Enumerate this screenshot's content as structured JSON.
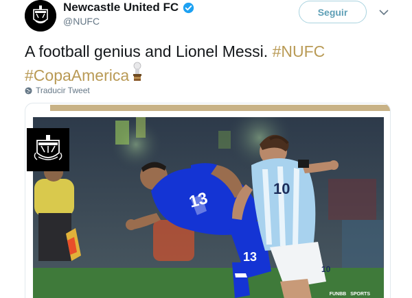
{
  "account": {
    "display_name": "Newcastle United FC",
    "handle": "@NUFC",
    "verified": true
  },
  "follow_button": {
    "label": "Seguir"
  },
  "tweet": {
    "text": "A football genius and Lionel Messi.",
    "hashtags": [
      "#NUFC",
      "#CopaAmerica"
    ],
    "emoji": "trophy-icon"
  },
  "translate": {
    "label": "Traducir Tweet"
  },
  "media": {
    "jersey_left": "13",
    "jersey_right": "10",
    "watermarks": [
      "FUNBB",
      "SPORTS"
    ]
  },
  "colors": {
    "hashtag": "#b99a55",
    "follow_border": "#a9d3df",
    "follow_text": "#5e9fb6",
    "gold_bar": "#c8b286",
    "paraguay_blue": "#1434d4",
    "argentina_sky": "#a8d2ee"
  }
}
